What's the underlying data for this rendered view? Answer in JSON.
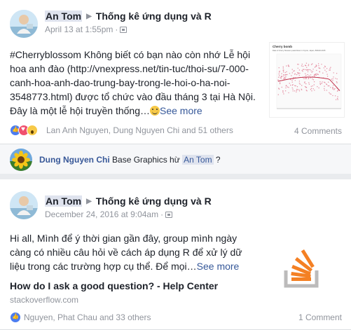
{
  "posts": [
    {
      "author": "An Tom",
      "group": "Thống kê ứng dụng và R",
      "timestamp": "April 13 at 1:55pm",
      "text_lines": [
        "#Cherryblossom Không biết có bạn nào còn nhớ Lễ hội",
        "hoa anh đào (http://vnexpress.net/tin-tuc/thoi-su/7-000-",
        "canh-hoa-anh-dao-trung-bay-trong-le-hoi-o-ha-noi-",
        "3548773.html) được tổ chức vào đầu tháng 3 tại Hà Nội.",
        "Đây là một lễ hội truyền thống…"
      ],
      "see_more": "See more",
      "reactions_text": "Lan Anh Nguyen, Dung Nguyen Chi and 51 others",
      "comments_count": "4 Comments",
      "thumbnail": {
        "title": "Cherry bomb",
        "subtitle": "Date of cherry blossom peak bloom in Kyoto, Japan, 800AD-2015"
      },
      "comment": {
        "author": "Dung Nguyen Chi",
        "text": "Base Graphics hừ",
        "mention": "An Tom",
        "suffix": "?"
      }
    },
    {
      "author": "An Tom",
      "group": "Thống kê ứng dụng và R",
      "timestamp": "December 24, 2016 at 9:04am",
      "text_lines": [
        "Hi all, Mình để ý thời gian gần đây, group mình ngày",
        "càng có nhiều câu hỏi về cách áp dụng R để xử lý dữ",
        "liệu trong các trường hợp cụ thể. Để mọi…"
      ],
      "see_more": "See more",
      "link_title": "How do I ask a good question? - Help Center",
      "link_domain": "stackoverflow.com",
      "reactions_text": "Nguyen, Phat Chau and 33 others",
      "comments_count": "1 Comment"
    }
  ],
  "colors": {
    "link": "#365899",
    "muted": "#90949c",
    "like": "#4c7df0",
    "love": "#f0506e",
    "wow": "#f7c948",
    "stackoverflow_orange": "#f48024",
    "stackoverflow_gray": "#bcbbbb"
  },
  "icons": [
    "avatar-photo",
    "privacy-closed-group-icon",
    "smile-emoji",
    "like-reaction-icon",
    "love-reaction-icon",
    "wow-reaction-icon",
    "sunflower-avatar",
    "stackoverflow-logo"
  ]
}
